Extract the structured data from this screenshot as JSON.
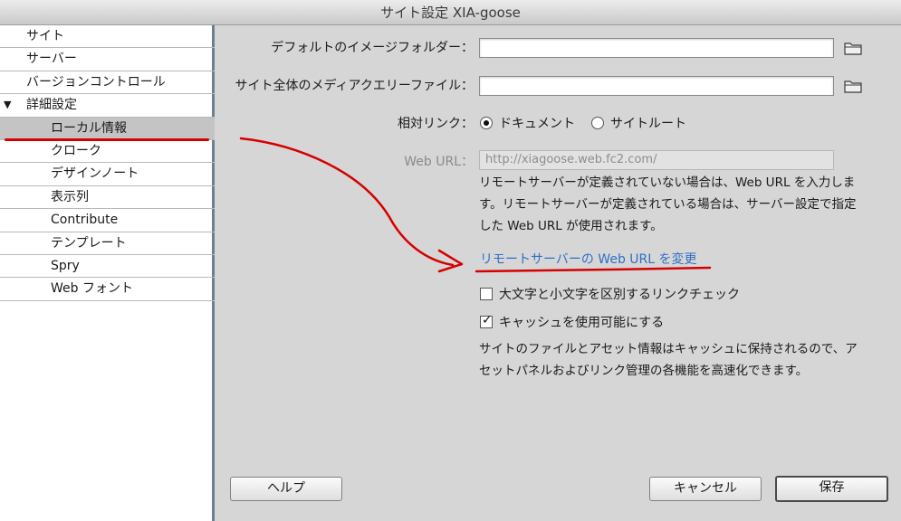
{
  "window": {
    "title": "サイト設定 XIA-goose"
  },
  "sidebar": {
    "items": [
      {
        "label": "サイト"
      },
      {
        "label": "サーバー"
      },
      {
        "label": "バージョンコントロール"
      },
      {
        "label": "詳細設定",
        "expanded": true
      },
      {
        "label": "ローカル情報",
        "selected": true
      },
      {
        "label": "クローク"
      },
      {
        "label": "デザインノート"
      },
      {
        "label": "表示列"
      },
      {
        "label": "Contribute"
      },
      {
        "label": "テンプレート"
      },
      {
        "label": "Spry"
      },
      {
        "label": "Web フォント"
      }
    ],
    "expand_glyph": "▼"
  },
  "form": {
    "default_image_folder_label": "デフォルトのイメージフォルダー：",
    "default_image_folder_value": "",
    "media_query_label": "サイト全体のメディアクエリーファイル：",
    "media_query_value": "",
    "relative_link_label": "相対リンク：",
    "relative_options": [
      "ドキュメント",
      "サイトルート"
    ],
    "relative_selected": "ドキュメント",
    "web_url_label": "Web URL：",
    "web_url_value": "http://xiagoose.web.fc2.com/",
    "web_url_help_lines": [
      "リモートサーバーが定義されていない場合は、Web URL を入力しま",
      "す。リモートサーバーが定義されている場合は、サーバー設定で指定",
      "した Web URL が使用されます。"
    ],
    "change_url_link": "リモートサーバーの Web URL を変更",
    "case_check_label": "大文字と小文字を区別するリンクチェック",
    "case_check_checked": false,
    "cache_label": "キャッシュを使用可能にする",
    "cache_checked": true,
    "cache_help_lines": [
      "サイトのファイルとアセット情報はキャッシュに保持されるので、ア",
      "セットパネルおよびリンク管理の各機能を高速化できます。"
    ]
  },
  "buttons": {
    "help": "ヘルプ",
    "cancel": "キャンセル",
    "save": "保存"
  },
  "colors": {
    "annotation": "#d60000",
    "link": "#2d6fc8",
    "selected_row": "#c4c4c4"
  },
  "icons": {
    "folder": "folder-icon",
    "expand": "triangle-down-icon"
  }
}
